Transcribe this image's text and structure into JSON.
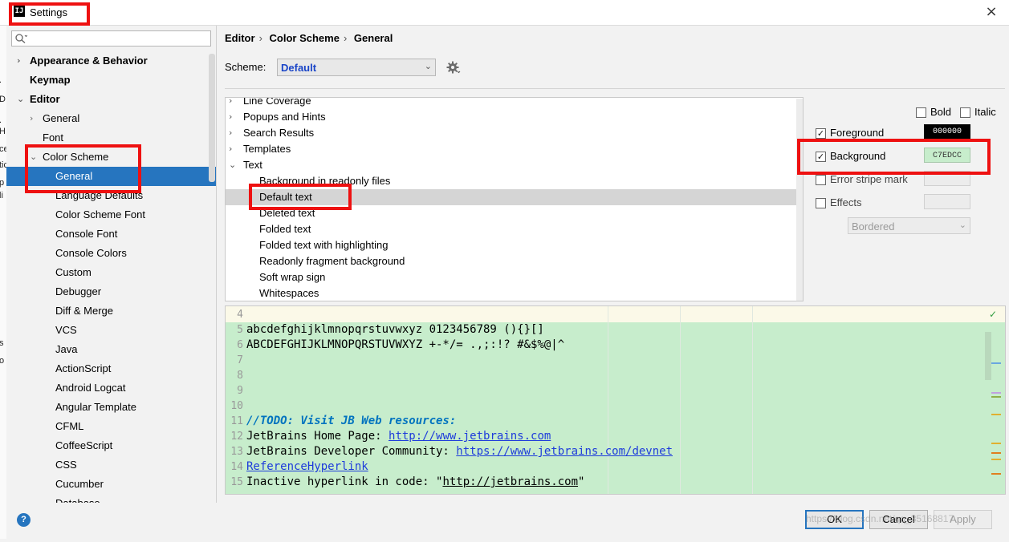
{
  "window": {
    "title": "Settings",
    "app_icon_text": "IJ"
  },
  "left_strip": [
    ".",
    "D",
    ".",
    "H",
    "ce",
    "tic",
    "p",
    "li",
    "s",
    "o"
  ],
  "search": {
    "placeholder": ""
  },
  "sidebar": {
    "items": [
      {
        "label": "Appearance & Behavior",
        "arrow": "›",
        "bold": true,
        "level": 0
      },
      {
        "label": "Keymap",
        "arrow": "",
        "bold": true,
        "level": 0
      },
      {
        "label": "Editor",
        "arrow": "⌄",
        "bold": true,
        "level": 0
      },
      {
        "label": "General",
        "arrow": "›",
        "bold": false,
        "level": 1
      },
      {
        "label": "Font",
        "arrow": "",
        "bold": false,
        "level": 1
      },
      {
        "label": "Color Scheme",
        "arrow": "⌄",
        "bold": false,
        "level": 1
      },
      {
        "label": "General",
        "arrow": "",
        "bold": false,
        "level": 2,
        "selected": true
      },
      {
        "label": "Language Defaults",
        "arrow": "",
        "bold": false,
        "level": 2
      },
      {
        "label": "Color Scheme Font",
        "arrow": "",
        "bold": false,
        "level": 2
      },
      {
        "label": "Console Font",
        "arrow": "",
        "bold": false,
        "level": 2
      },
      {
        "label": "Console Colors",
        "arrow": "",
        "bold": false,
        "level": 2
      },
      {
        "label": "Custom",
        "arrow": "",
        "bold": false,
        "level": 2
      },
      {
        "label": "Debugger",
        "arrow": "",
        "bold": false,
        "level": 2
      },
      {
        "label": "Diff & Merge",
        "arrow": "",
        "bold": false,
        "level": 2
      },
      {
        "label": "VCS",
        "arrow": "",
        "bold": false,
        "level": 2
      },
      {
        "label": "Java",
        "arrow": "",
        "bold": false,
        "level": 2
      },
      {
        "label": "ActionScript",
        "arrow": "",
        "bold": false,
        "level": 2
      },
      {
        "label": "Android Logcat",
        "arrow": "",
        "bold": false,
        "level": 2
      },
      {
        "label": "Angular Template",
        "arrow": "",
        "bold": false,
        "level": 2
      },
      {
        "label": "CFML",
        "arrow": "",
        "bold": false,
        "level": 2
      },
      {
        "label": "CoffeeScript",
        "arrow": "",
        "bold": false,
        "level": 2
      },
      {
        "label": "CSS",
        "arrow": "",
        "bold": false,
        "level": 2
      },
      {
        "label": "Cucumber",
        "arrow": "",
        "bold": false,
        "level": 2
      },
      {
        "label": "Database",
        "arrow": "",
        "bold": false,
        "level": 2
      }
    ]
  },
  "breadcrumb": {
    "parts": [
      "Editor",
      "Color Scheme",
      "General"
    ],
    "separator": "›"
  },
  "scheme": {
    "label": "Scheme:",
    "value": "Default",
    "chevron": "⌄"
  },
  "attributes": {
    "items": [
      {
        "label": "Line Coverage",
        "arrow": "›",
        "level": 0
      },
      {
        "label": "Popups and Hints",
        "arrow": "›",
        "level": 0
      },
      {
        "label": "Search Results",
        "arrow": "›",
        "level": 0
      },
      {
        "label": "Templates",
        "arrow": "›",
        "level": 0
      },
      {
        "label": "Text",
        "arrow": "⌄",
        "level": 0
      },
      {
        "label": "Background in readonly files",
        "arrow": "",
        "level": 1
      },
      {
        "label": "Default text",
        "arrow": "",
        "level": 1,
        "selected": true
      },
      {
        "label": "Deleted text",
        "arrow": "",
        "level": 1
      },
      {
        "label": "Folded text",
        "arrow": "",
        "level": 1
      },
      {
        "label": "Folded text with highlighting",
        "arrow": "",
        "level": 1
      },
      {
        "label": "Readonly fragment background",
        "arrow": "",
        "level": 1
      },
      {
        "label": "Soft wrap sign",
        "arrow": "",
        "level": 1
      },
      {
        "label": "Whitespaces",
        "arrow": "",
        "level": 1
      }
    ]
  },
  "options": {
    "bold": {
      "label": "Bold",
      "checked": false
    },
    "italic": {
      "label": "Italic",
      "checked": false
    },
    "foreground": {
      "label": "Foreground",
      "checked": true,
      "color_text": "000000",
      "color": "#000000"
    },
    "background": {
      "label": "Background",
      "checked": true,
      "color_text": "C7EDCC",
      "color": "#c7edcc"
    },
    "error_stripe": {
      "label": "Error stripe mark",
      "checked": false
    },
    "effects": {
      "label": "Effects",
      "checked": false,
      "style": "Bordered",
      "chevron": "⌄"
    },
    "check_mark": "✓"
  },
  "preview": {
    "background": "#c7edcc",
    "lines": [
      {
        "num": "4",
        "parts": []
      },
      {
        "num": "5",
        "parts": [
          {
            "t": "abcdefghijklmnopqrstuvwxyz 0123456789 (){}[]",
            "c": ""
          }
        ]
      },
      {
        "num": "6",
        "parts": [
          {
            "t": "ABCDEFGHIJKLMNOPQRSTUVWXYZ +-*/= .,;:!? #&$%@|^",
            "c": ""
          }
        ]
      },
      {
        "num": "7",
        "parts": []
      },
      {
        "num": "8",
        "parts": []
      },
      {
        "num": "9",
        "parts": []
      },
      {
        "num": "10",
        "parts": []
      },
      {
        "num": "11",
        "parts": [
          {
            "t": "//TODO: Visit JB Web resources:",
            "c": "kw-todo"
          }
        ]
      },
      {
        "num": "12",
        "parts": [
          {
            "t": "JetBrains Home Page: ",
            "c": ""
          },
          {
            "t": "http://www.jetbrains.com",
            "c": "link"
          }
        ]
      },
      {
        "num": "13",
        "parts": [
          {
            "t": "JetBrains Developer Community: ",
            "c": ""
          },
          {
            "t": "https://www.jetbrains.com/devnet",
            "c": "link"
          }
        ]
      },
      {
        "num": "14",
        "parts": [
          {
            "t": "ReferenceHyperlink",
            "c": "link"
          }
        ]
      },
      {
        "num": "15",
        "parts": [
          {
            "t": "Inactive hyperlink in code: \"",
            "c": ""
          },
          {
            "t": "http://jetbrains.com",
            "c": "link-inactive"
          },
          {
            "t": "\"",
            "c": ""
          }
        ]
      }
    ],
    "gutter_marks": [
      "#6aa6e0",
      "#c0a0e0",
      "#8fb04a",
      "#e0b030",
      "#e0b030",
      "#e07f1f",
      "#e0b030",
      "#e07f1f"
    ]
  },
  "buttons": {
    "help": "?",
    "ok": "OK",
    "cancel": "Cancel",
    "apply": "Apply"
  },
  "watermark": "https://blog.csdn.net/qq_35168817",
  "colors": {
    "selection": "#2675bf",
    "highlight_box": "#ee1111"
  }
}
